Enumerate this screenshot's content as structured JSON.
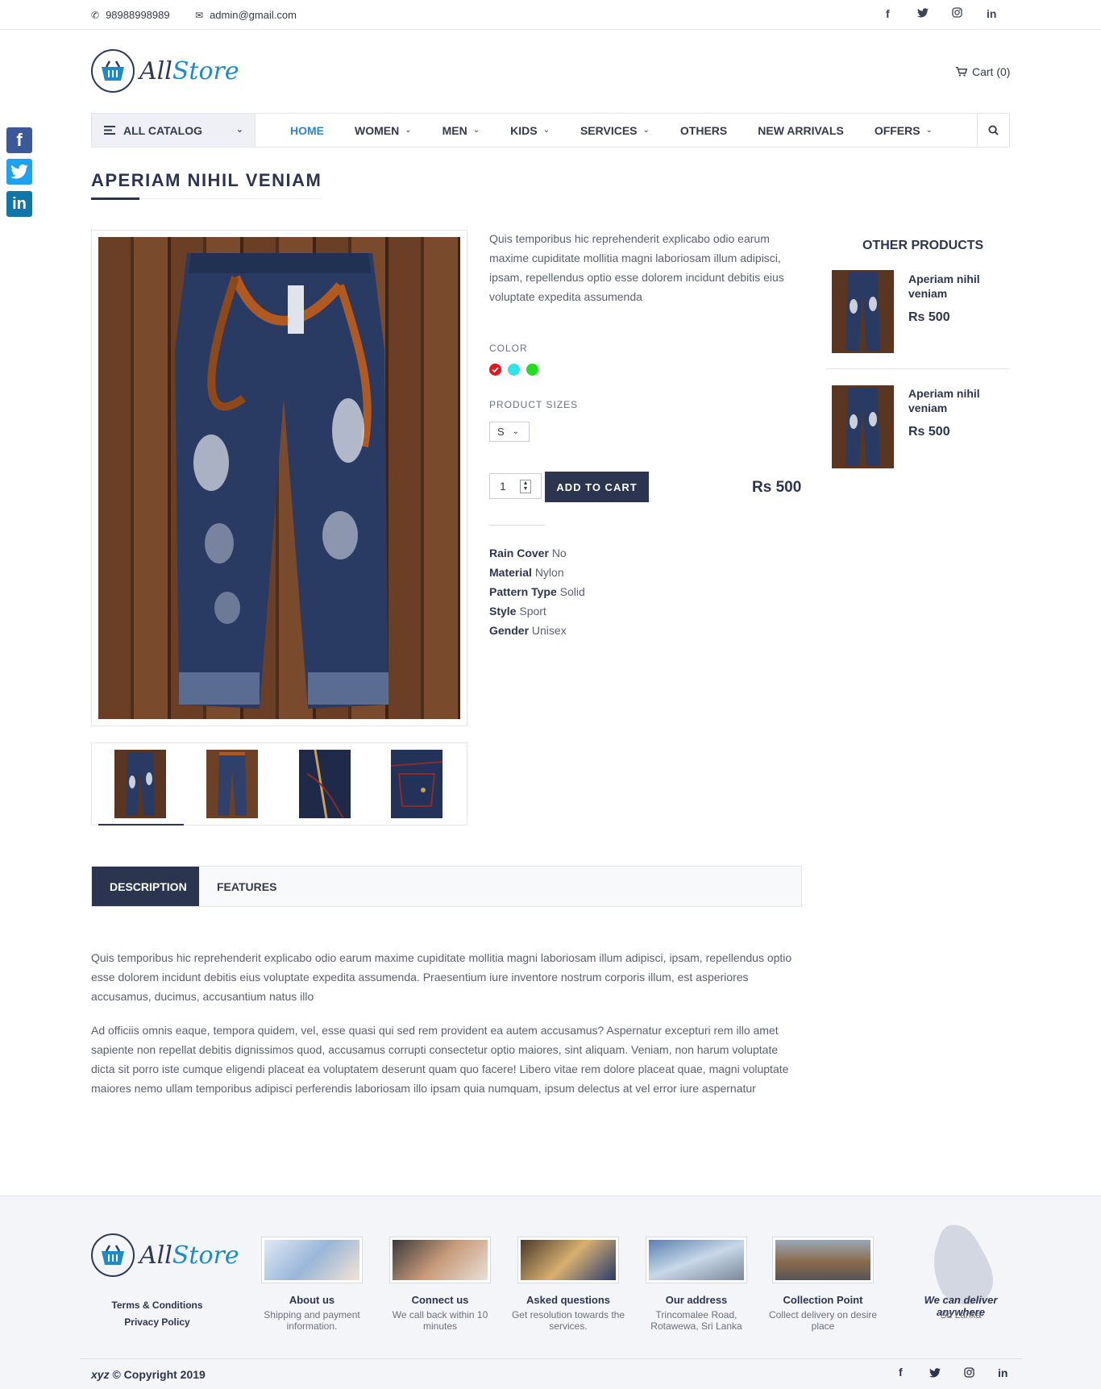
{
  "topbar": {
    "phone": "98988998989",
    "email": "admin@gmail.com",
    "social": [
      "f",
      "t",
      "ig",
      "in"
    ]
  },
  "header": {
    "logo_part1": "All",
    "logo_part2": "Store",
    "cart_label": "Cart (0)"
  },
  "nav": {
    "catalog_label": "ALL CATALOG",
    "items": [
      {
        "label": "HOME",
        "active": true,
        "dropdown": false
      },
      {
        "label": "WOMEN",
        "dropdown": true
      },
      {
        "label": "MEN",
        "dropdown": true
      },
      {
        "label": "KIDS",
        "dropdown": true
      },
      {
        "label": "SERVICES",
        "dropdown": true
      },
      {
        "label": "OTHERS",
        "dropdown": false
      },
      {
        "label": "NEW ARRIVALS",
        "dropdown": false
      },
      {
        "label": "OFFERS",
        "dropdown": true
      }
    ]
  },
  "side_social": [
    "facebook-icon",
    "twitter-icon",
    "linkedin-icon"
  ],
  "product": {
    "title": "APERIAM NIHIL VENIAM",
    "short_description": "Quis temporibus hic reprehenderit explicabo odio earum maxime cupiditate mollitia magni laboriosam illum adipisci, ipsam, repellendus optio esse dolorem incidunt debitis eius voluptate expedita assumenda",
    "color_label": "COLOR",
    "colors": [
      "#e8141c",
      "#2ee3ea",
      "#1ee01e"
    ],
    "selected_color": 0,
    "sizes_label": "PRODUCT SIZES",
    "size_value": "S",
    "quantity": "1",
    "add_to_cart": "ADD TO CART",
    "price": "Rs 500",
    "attributes": [
      {
        "key": "Rain Cover",
        "value": "No"
      },
      {
        "key": "Material",
        "value": "Nylon"
      },
      {
        "key": "Pattern Type",
        "value": "Solid"
      },
      {
        "key": "Style",
        "value": "Sport"
      },
      {
        "key": "Gender",
        "value": "Unisex"
      }
    ]
  },
  "other_products": {
    "title": "OTHER PRODUCTS",
    "items": [
      {
        "name": "Aperiam nihil veniam",
        "price": "Rs 500"
      },
      {
        "name": "Aperiam nihil veniam",
        "price": "Rs 500"
      }
    ]
  },
  "tabs": {
    "description": "DESCRIPTION",
    "features": "FEATURES",
    "paragraph1": "Quis temporibus hic reprehenderit explicabo odio earum maxime cupiditate mollitia magni laboriosam illum adipisci, ipsam, repellendus optio esse dolorem incidunt debitis eius voluptate expedita assumenda. Praesentium iure inventore nostrum corporis illum, est asperiores accusamus, ducimus, accusantium natus illo",
    "paragraph2": "Ad officiis omnis eaque, tempora quidem, vel, esse quasi qui sed rem provident ea autem accusamus? Aspernatur excepturi rem illo amet sapiente non repellat debitis dignissimos quod, accusamus corrupti consectetur optio maiores, sint aliquam. Veniam, non harum voluptate dicta sit porro iste cumque eligendi placeat ea voluptatem deserunt quam quo facere! Libero vitae rem dolore placeat quae, magni voluptate maiores nemo ullam temporibus adipisci perferendis laboriosam illo ipsam quia numquam, ipsum delectus at vel error iure aspernatur"
  },
  "footer": {
    "terms": "Terms & Conditions",
    "privacy": "Privacy Policy",
    "cards": [
      {
        "title": "About us",
        "sub": "Shipping and payment information."
      },
      {
        "title": "Connect us",
        "sub": "We call back within 10 minutes"
      },
      {
        "title": "Asked questions",
        "sub": "Get resolution towards the services."
      },
      {
        "title": "Our address",
        "sub": "Trincomalee Road, Rotawewa, Sri Lanka"
      },
      {
        "title": "Collection Point",
        "sub": "Collect delivery on desire place"
      }
    ],
    "deliver_title": "We can deliver anywhere",
    "deliver_sub": "Sri Lanka",
    "copyright_brand": "xyz",
    "copyright_text": " © Copyright 2019"
  }
}
